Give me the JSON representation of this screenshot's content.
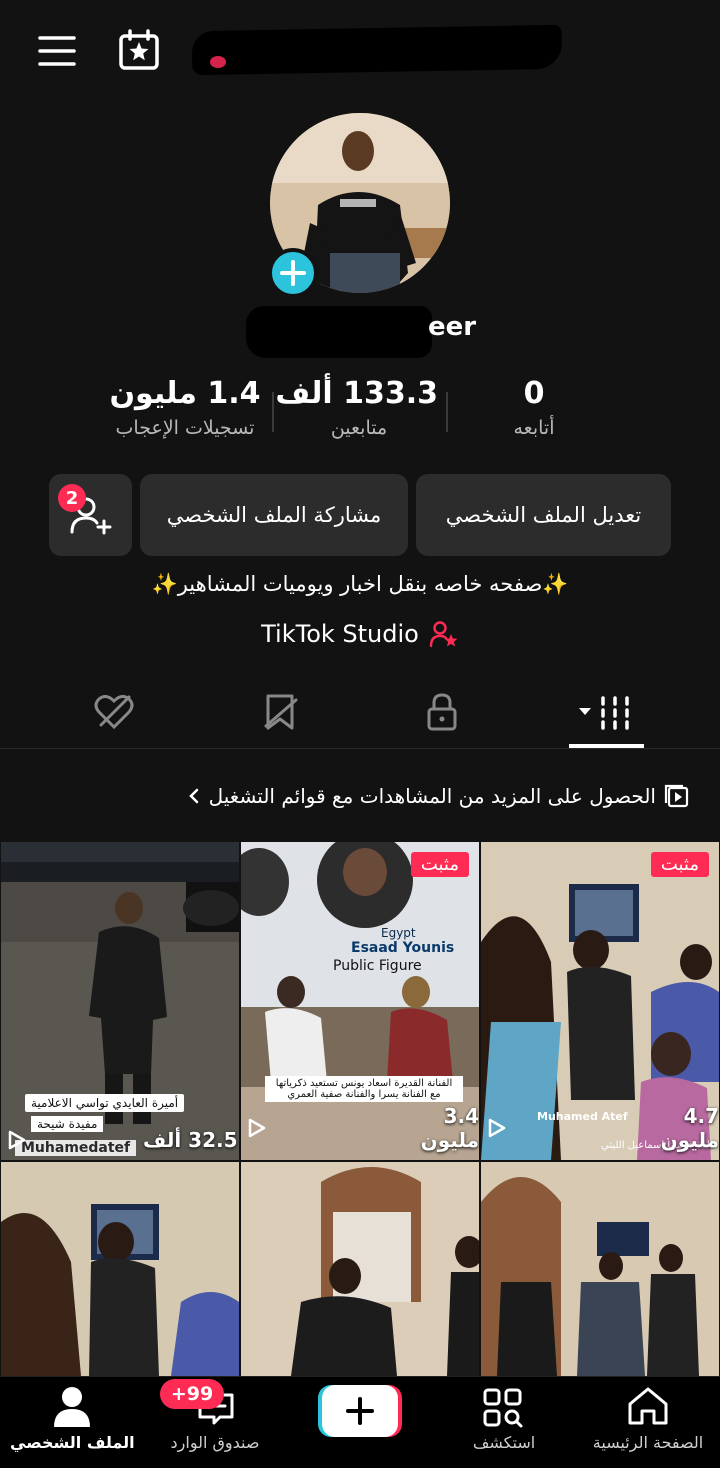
{
  "header": {
    "username_tail": "eer"
  },
  "stats": [
    {
      "value": "1.4 مليون",
      "label": "تسجيلات الإعجاب"
    },
    {
      "value": "133.3 ألف",
      "label": "متابعين"
    },
    {
      "value": "0",
      "label": "أتابعه"
    }
  ],
  "buttons": {
    "edit_profile": "تعديل الملف الشخصي",
    "share_profile": "مشاركة الملف الشخصي",
    "friend_requests_count": "2"
  },
  "bio": "✨صفحه خاصه بنقل اخبار ويوميات المشاهير✨",
  "studio": "TikTok Studio",
  "playlist_prompt": "الحصول على المزيد من المشاهدات مع قوائم التشغيل",
  "videos": [
    {
      "views": "32.5 ألف",
      "pinned": false,
      "caption_1": "أميرة العايدي تواسي الاعلامية",
      "caption_2": "مفيدة شيحة",
      "watermark": "Muhamedatef"
    },
    {
      "views": "3.4 مليون",
      "pinned": true,
      "pin_label": "مثبت",
      "caption_1": "الفنانة القديرة اسعاد يونس تستعيد ذكرياتها",
      "caption_2": "مع الفنانة يسرا والفنانة صفية العمري",
      "poster_name": "Esaad Younis",
      "poster_role": "Public Figure",
      "poster_country": "Egypt"
    },
    {
      "views": "4.7 مليون",
      "pinned": true,
      "pin_label": "مثبت",
      "caption_1": "والدة فاضلنا إسماعيل الليثي",
      "watermark": "Muhamed Atef"
    },
    {
      "views": "",
      "pinned": false
    },
    {
      "views": "",
      "pinned": false
    },
    {
      "views": "",
      "pinned": false
    }
  ],
  "bottom_nav": {
    "home": "الصفحة الرئيسية",
    "discover": "استكشف",
    "inbox": "صندوق الوارد",
    "profile": "الملف الشخصي",
    "inbox_badge": "+99"
  },
  "colors": {
    "accent": "#fe2c55",
    "cyan": "#2cc4dc",
    "background": "#121212",
    "button": "#2c2c2c"
  }
}
